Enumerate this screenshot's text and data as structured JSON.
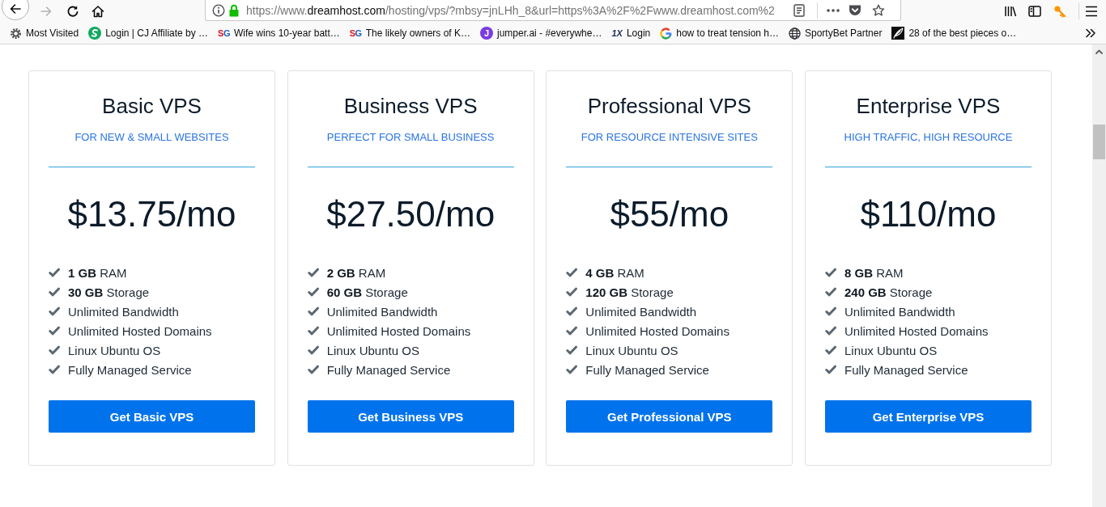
{
  "toolbar": {
    "address_bar": {
      "url_start": "https://www.",
      "url_domain": "dreamhost.com",
      "url_end": "/hosting/vps/?mbsy=jnLHh_8&url=https%3A%2F%2Fwww.dreamhost.com%2"
    }
  },
  "bookmarks": [
    {
      "kind": "gear",
      "label": "Most Visited"
    },
    {
      "kind": "swirl",
      "label": "Login | CJ Affiliate by …"
    },
    {
      "kind": "letters",
      "logo": "SG",
      "label": "Wife wins 10-year batt…"
    },
    {
      "kind": "letters",
      "logo": "SG",
      "label": "The likely owners of K…"
    },
    {
      "kind": "avatar",
      "logo": "J",
      "label": "jumper.ai - #everywhe…"
    },
    {
      "kind": "italic",
      "logo": "1X",
      "label": "Login"
    },
    {
      "kind": "google",
      "label": "how to treat tension h…"
    },
    {
      "kind": "globe",
      "label": "SportyBet Partner"
    },
    {
      "kind": "thumbnail",
      "label": "28 of the best pieces o…"
    }
  ],
  "plans": [
    {
      "title": "Basic VPS",
      "subtitle": "FOR NEW & SMALL WEBSITES",
      "price": "$13.75/mo",
      "features": [
        "**1 GB** RAM",
        "**30 GB** Storage",
        "Unlimited Bandwidth",
        "Unlimited Hosted Domains",
        "Linux Ubuntu OS",
        "Fully Managed Service"
      ],
      "button": "Get Basic VPS"
    },
    {
      "title": "Business VPS",
      "subtitle": "PERFECT FOR SMALL BUSINESS",
      "price": "$27.50/mo",
      "features": [
        "**2 GB** RAM",
        "**60 GB** Storage",
        "Unlimited Bandwidth",
        "Unlimited Hosted Domains",
        "Linux Ubuntu OS",
        "Fully Managed Service"
      ],
      "button": "Get Business VPS"
    },
    {
      "title": "Professional VPS",
      "subtitle": "FOR RESOURCE INTENSIVE SITES",
      "price": "$55/mo",
      "features": [
        "**4 GB** RAM",
        "**120 GB** Storage",
        "Unlimited Bandwidth",
        "Unlimited Hosted Domains",
        "Linux Ubuntu OS",
        "Fully Managed Service"
      ],
      "button": "Get Professional VPS"
    },
    {
      "title": "Enterprise VPS",
      "subtitle": "HIGH TRAFFIC, HIGH RESOURCE",
      "price": "$110/mo",
      "features": [
        "**8 GB** RAM",
        "**240 GB** Storage",
        "Unlimited Bandwidth",
        "Unlimited Hosted Domains",
        "Linux Ubuntu OS",
        "Fully Managed Service"
      ],
      "button": "Get Enterprise VPS"
    }
  ]
}
